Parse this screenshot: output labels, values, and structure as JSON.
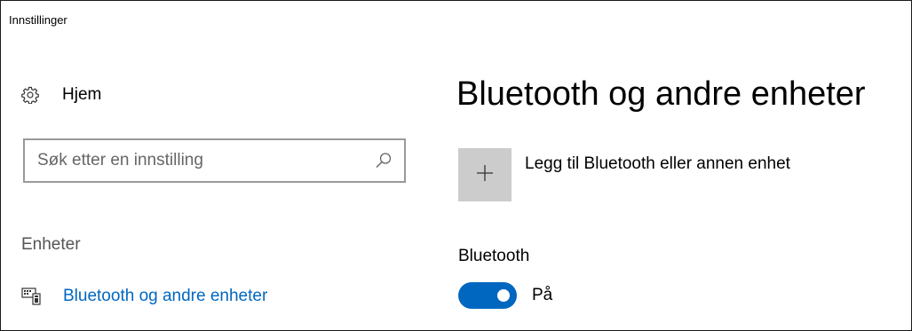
{
  "window": {
    "title": "Innstillinger"
  },
  "sidebar": {
    "home": {
      "label": "Hjem",
      "icon": "gear-icon"
    },
    "search": {
      "placeholder": "Søk etter en innstilling",
      "value": "",
      "icon": "search-icon"
    },
    "section_header": "Enheter",
    "items": [
      {
        "label": "Bluetooth og andre enheter",
        "icon": "devices-icon",
        "selected": true
      }
    ]
  },
  "main": {
    "title": "Bluetooth og andre enheter",
    "add_device": {
      "label": "Legg til Bluetooth eller annen enhet",
      "icon": "plus-icon"
    },
    "bluetooth": {
      "label": "Bluetooth",
      "state_label": "På",
      "on": true
    }
  },
  "colors": {
    "accent": "#0067c0",
    "tile_background": "#cccccc",
    "search_border": "#999999",
    "muted_text": "#555555"
  }
}
